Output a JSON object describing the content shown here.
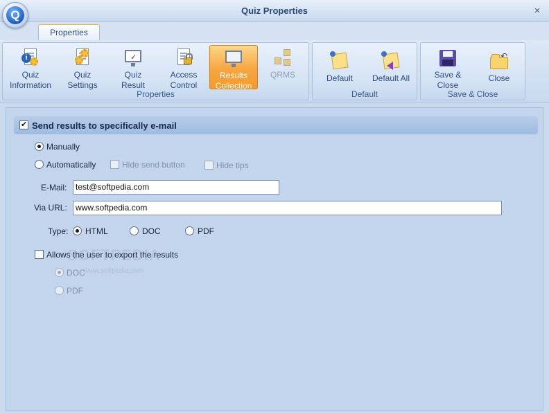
{
  "window": {
    "title": "Quiz Properties",
    "app_letter": "Q",
    "close_glyph": "×"
  },
  "ribbon": {
    "tab": "Properties",
    "groups": {
      "properties": {
        "label": "Properties",
        "buttons": [
          {
            "line1": "Quiz",
            "line2": "Information",
            "icon": "quiz-information-icon"
          },
          {
            "line1": "Quiz",
            "line2": "Settings",
            "icon": "quiz-settings-icon"
          },
          {
            "line1": "Quiz",
            "line2": "Result",
            "icon": "quiz-result-icon"
          },
          {
            "line1": "Access",
            "line2": "Control",
            "icon": "access-control-icon"
          },
          {
            "line1": "Results",
            "line2": "Collection",
            "icon": "results-collection-icon",
            "active": true
          },
          {
            "line1": "QRMS",
            "line2": "",
            "icon": "qrms-icon",
            "disabled": true
          }
        ]
      },
      "default": {
        "label": "Default",
        "buttons": [
          {
            "line1": "Default",
            "icon": "default-icon"
          },
          {
            "line1": "Default All",
            "icon": "default-all-icon"
          }
        ]
      },
      "save_close": {
        "label": "Save & Close",
        "buttons": [
          {
            "line1": "Save &",
            "line2": "Close",
            "icon": "save-icon"
          },
          {
            "line1": "Close",
            "icon": "close-folder-icon"
          }
        ]
      }
    }
  },
  "section": {
    "title": "Send results to specifically e-mail",
    "enabled": true,
    "mode": {
      "manually": "Manually",
      "automatically": "Automatically",
      "selected": "Manually"
    },
    "hide_send_button": "Hide send button",
    "hide_tips": "Hide tips",
    "email_label": "E-Mail:",
    "email_value": "test@softpedia.com",
    "url_label": "Via URL:",
    "url_value": "www.softpedia.com",
    "type_label": "Type:",
    "types": [
      "HTML",
      "DOC",
      "PDF"
    ],
    "type_selected": "HTML",
    "export_label": "Allows the user to export the results",
    "export_enabled": false,
    "export_formats": [
      "DOC",
      "PDF"
    ],
    "export_selected": "DOC"
  },
  "watermark": {
    "text": "SOFTPEDIA",
    "sub": "www.softpedia.com"
  },
  "colors": {
    "accent_orange": "#f6a640",
    "panel_bg": "#c2d5ec",
    "header_bg": "#9ebbe0"
  }
}
